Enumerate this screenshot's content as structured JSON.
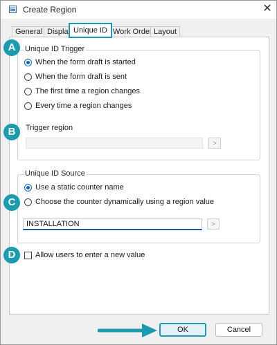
{
  "window": {
    "title": "Create Region",
    "close_glyph": "✕"
  },
  "tabs": [
    {
      "label": "General",
      "active": false
    },
    {
      "label": "Display",
      "active": false
    },
    {
      "label": "Unique ID",
      "active": true
    },
    {
      "label": "Work Order",
      "active": false
    },
    {
      "label": "Layout",
      "active": false
    }
  ],
  "trigger": {
    "legend": "Unique ID Trigger",
    "options": [
      {
        "label": "When the form draft is started",
        "selected": true
      },
      {
        "label": "When the form draft is sent",
        "selected": false
      },
      {
        "label": "The first time a region changes",
        "selected": false
      },
      {
        "label": "Every time a region changes",
        "selected": false
      }
    ],
    "region_label": "Trigger region",
    "region_value": "",
    "browse_glyph": ">"
  },
  "source": {
    "legend": "Unique ID Source",
    "options": [
      {
        "label": "Use a static counter name",
        "selected": true
      },
      {
        "label": "Choose the counter dynamically using a region value",
        "selected": false
      }
    ],
    "counter_value": "INSTALLATION",
    "browse_glyph": ">"
  },
  "allow_new": {
    "label": "Allow users to enter a new value",
    "checked": false
  },
  "badges": [
    "A",
    "B",
    "C",
    "D"
  ],
  "buttons": {
    "ok": "OK",
    "cancel": "Cancel"
  },
  "colors": {
    "accent": "#1a9bb0",
    "radio_selected": "#0a64c8",
    "field_underline": "#1a5aa8"
  }
}
